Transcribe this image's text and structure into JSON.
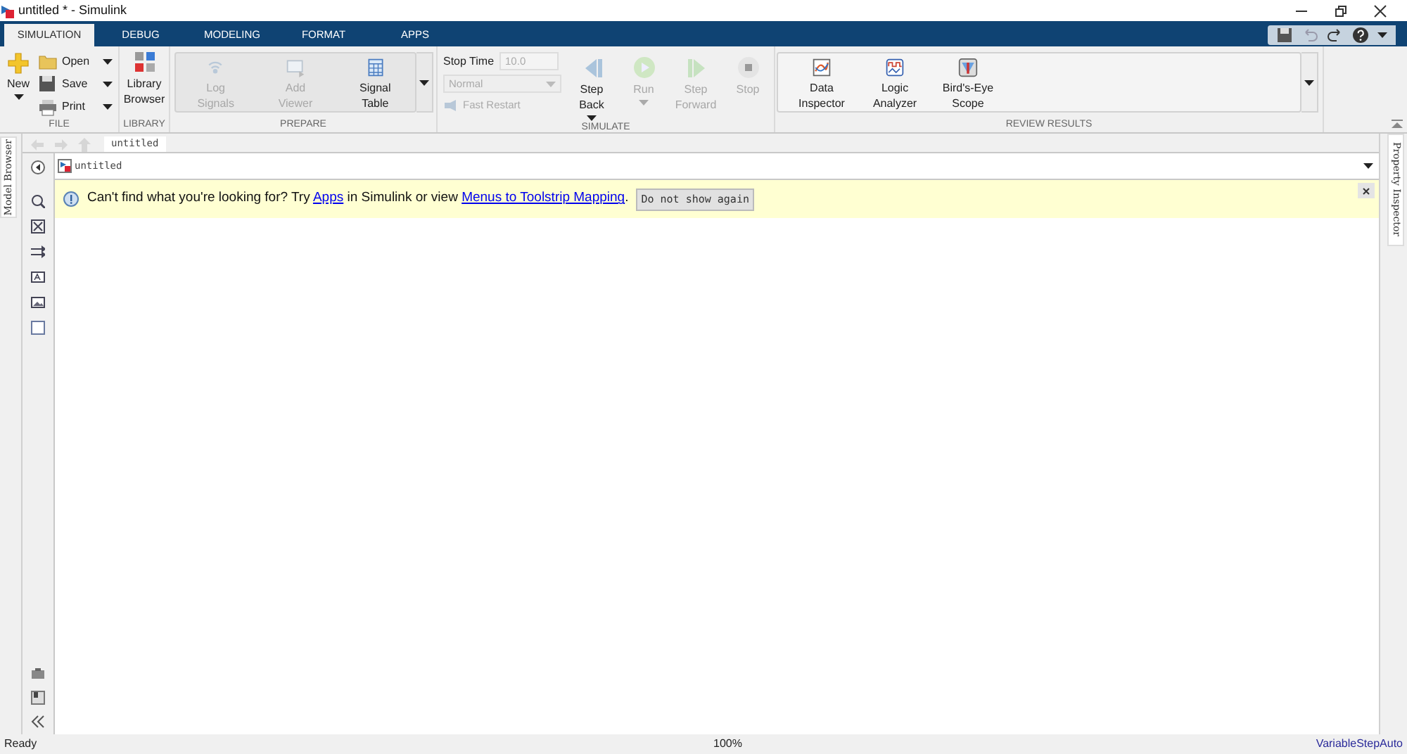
{
  "window": {
    "title": "untitled * - Simulink"
  },
  "tabs": [
    {
      "label": "SIMULATION",
      "selected": true
    },
    {
      "label": "DEBUG",
      "selected": false
    },
    {
      "label": "MODELING",
      "selected": false
    },
    {
      "label": "FORMAT",
      "selected": false
    },
    {
      "label": "APPS",
      "selected": false
    }
  ],
  "toolstrip": {
    "file": {
      "label": "FILE",
      "new": "New",
      "open": "Open",
      "save": "Save",
      "print": "Print"
    },
    "library": {
      "label": "LIBRARY",
      "browser": [
        "Library",
        "Browser"
      ]
    },
    "prepare": {
      "label": "PREPARE",
      "items": [
        {
          "lines": [
            "Log",
            "Signals"
          ],
          "disabled": true
        },
        {
          "lines": [
            "Add",
            "Viewer"
          ],
          "disabled": true
        },
        {
          "lines": [
            "Signal",
            "Table"
          ],
          "disabled": false
        }
      ]
    },
    "simulate": {
      "label": "SIMULATE",
      "stop_time_label": "Stop Time",
      "stop_time": "10.0",
      "mode": "Normal",
      "mode_disabled": true,
      "fast_restart": "Fast Restart",
      "fast_restart_disabled": true,
      "buttons": [
        {
          "lines": [
            "Step",
            "Back"
          ],
          "disabled": false,
          "dropdown": true
        },
        {
          "lines": [
            "Run"
          ],
          "disabled": true,
          "dropdown": true
        },
        {
          "lines": [
            "Step",
            "Forward"
          ],
          "disabled": true,
          "dropdown": false
        },
        {
          "lines": [
            "Stop"
          ],
          "disabled": true,
          "dropdown": false
        }
      ]
    },
    "review": {
      "label": "REVIEW RESULTS",
      "items": [
        {
          "lines": [
            "Data",
            "Inspector"
          ]
        },
        {
          "lines": [
            "Logic",
            "Analyzer"
          ]
        },
        {
          "lines": [
            "Bird's-Eye",
            "Scope"
          ]
        }
      ]
    }
  },
  "model_browser": {
    "label": "Model Browser"
  },
  "property_inspector": {
    "label": "Property Inspector"
  },
  "breadcrumb_tab": "untitled",
  "address": "untitled",
  "banner": {
    "before": "Can't find what you're looking for? Try ",
    "link1": "Apps",
    "middle": " in Simulink or view ",
    "link2": "Menus to Toolstrip Mapping",
    "after": ".",
    "button": "Do not show again"
  },
  "status_bar": {
    "left": "Ready",
    "zoom": "100%",
    "solver": "VariableStepAuto"
  }
}
